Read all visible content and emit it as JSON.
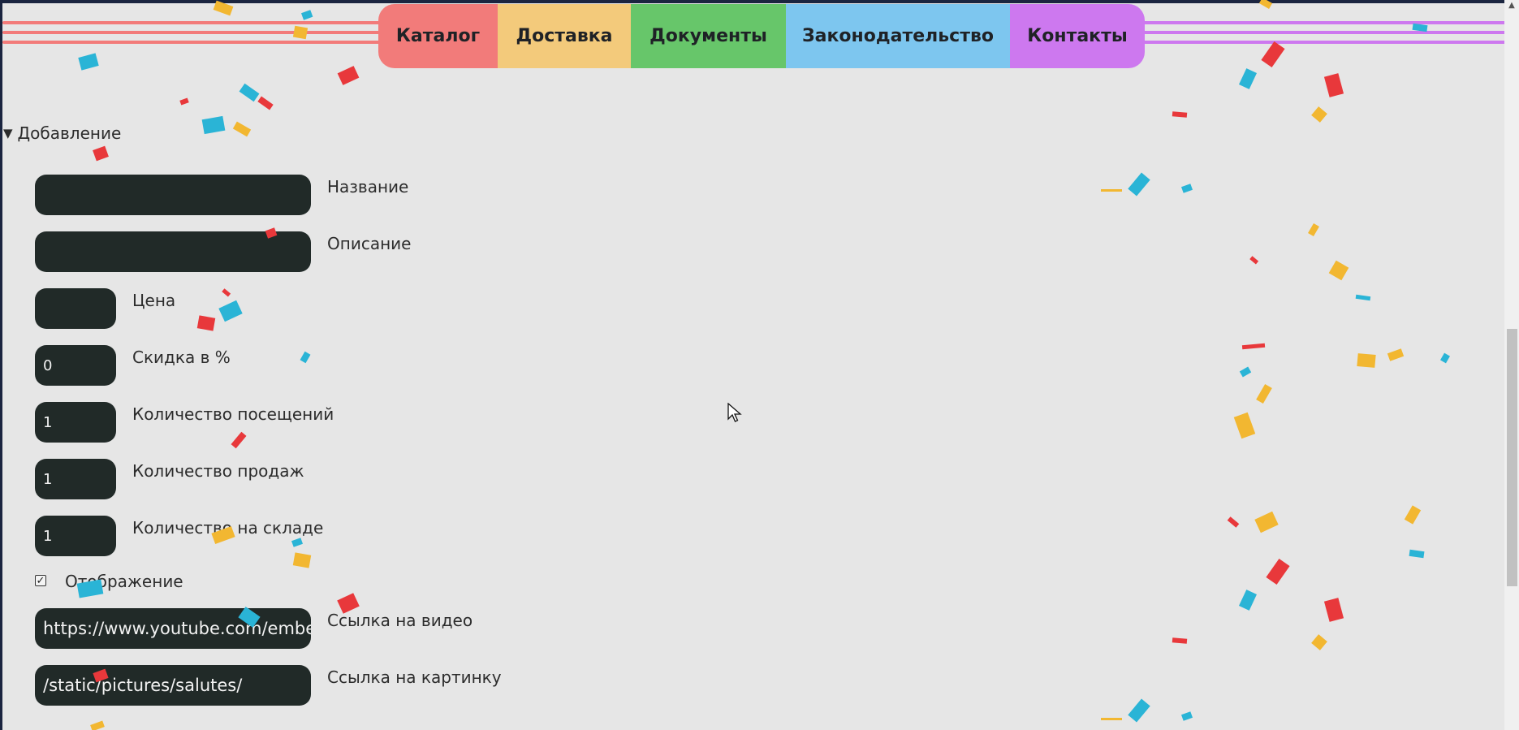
{
  "nav": {
    "items": [
      {
        "label": "Каталог",
        "color": "#f27b7a"
      },
      {
        "label": "Доставка",
        "color": "#f3ca7b"
      },
      {
        "label": "Документы",
        "color": "#67c66a"
      },
      {
        "label": "Законодательство",
        "color": "#7dc6ef"
      },
      {
        "label": "Контакты",
        "color": "#cd78ef"
      }
    ],
    "stripe_left_color": "#f27b7a",
    "stripe_right_color": "#cd78ef"
  },
  "section": {
    "title": "Добавление",
    "expanded": true
  },
  "form": {
    "name": {
      "label": "Название",
      "value": ""
    },
    "description": {
      "label": "Описание",
      "value": ""
    },
    "price": {
      "label": "Цена",
      "value": ""
    },
    "discount": {
      "label": "Скидка в %",
      "value": "0"
    },
    "visits": {
      "label": "Количество посещений",
      "value": "1"
    },
    "sales": {
      "label": "Количество продаж",
      "value": "1"
    },
    "stock": {
      "label": "Количество на складе",
      "value": "1"
    },
    "display": {
      "label": "Отображение",
      "checked": true
    },
    "video": {
      "label": "Ссылка на видео",
      "value": "https://www.youtube.com/embe"
    },
    "image": {
      "label": "Ссылка на картинку",
      "value": "/static/pictures/salutes/"
    }
  },
  "colors": {
    "field_bg": "#212a28",
    "page_bg": "#e6e6e6",
    "confetti": [
      "#e8383b",
      "#2ab4d6",
      "#f2b731"
    ]
  }
}
